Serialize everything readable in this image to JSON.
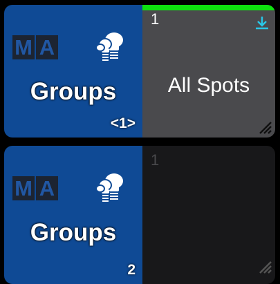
{
  "cards": [
    {
      "logo": {
        "m": "M",
        "a": "A"
      },
      "title": "Groups",
      "page_indicator": "<1>",
      "executor_number": "1",
      "content": "All Spots"
    },
    {
      "logo": {
        "m": "M",
        "a": "A"
      },
      "title": "Groups",
      "page_indicator": "2",
      "executor_number": "1",
      "content": ""
    }
  ],
  "colors": {
    "left_panel": "#0f4a95",
    "active_bar": "#0fe10f",
    "download_icon": "#29c6e6"
  },
  "icons": [
    "bulbs-icon",
    "download-icon",
    "resize-grip-icon"
  ]
}
